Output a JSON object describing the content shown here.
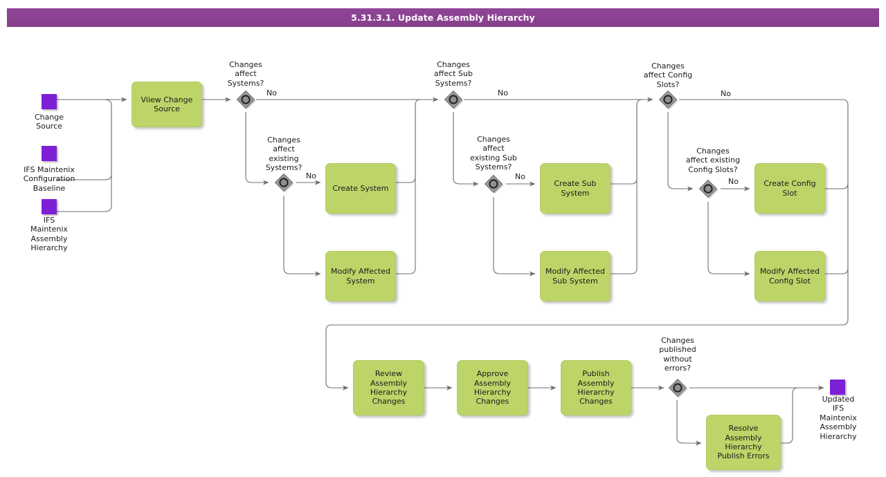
{
  "header": {
    "title": "5.31.3.1. Update Assembly Hierarchy"
  },
  "colors": {
    "header_purple": "#8b4292",
    "task_green": "#bdd568",
    "data_object_purple": "#7d1fd6",
    "gateway_gray": "#9a9a9a",
    "connector_gray": "#707070"
  },
  "diagram": {
    "type": "bpmn-process-flow",
    "data_objects": [
      {
        "id": "do-change-source",
        "label": "Change\nSource"
      },
      {
        "id": "do-config-baseline",
        "label": "IFS Maintenix\nConfiguration\nBaseline"
      },
      {
        "id": "do-assembly-hierarchy",
        "label": "IFS\nMaintenix\nAssembly\nHierarchy"
      },
      {
        "id": "do-updated-hierarchy",
        "label": "Updated\nIFS\nMaintenix\nAssembly\nHierarchy"
      }
    ],
    "tasks": [
      {
        "id": "task-view-change-source",
        "label": "Viiew Change\nSource"
      },
      {
        "id": "task-create-system",
        "label": "Create System"
      },
      {
        "id": "task-modify-affected-system",
        "label": "Modify Affected\nSystem"
      },
      {
        "id": "task-create-sub-system",
        "label": "Create Sub\nSystem"
      },
      {
        "id": "task-modify-affected-sub-system",
        "label": "Modify Affected\nSub System"
      },
      {
        "id": "task-create-config-slot",
        "label": "Create Config\nSlot"
      },
      {
        "id": "task-modify-affected-config-slot",
        "label": "Modify Affected\nConfig Slot"
      },
      {
        "id": "task-review-changes",
        "label": "Review\nAssembly\nHierarchy\nChanges"
      },
      {
        "id": "task-approve-changes",
        "label": "Approve\nAssembly\nHierarchy\nChanges"
      },
      {
        "id": "task-publish-changes",
        "label": "Publish\nAssembly\nHierarchy\nChanges"
      },
      {
        "id": "task-resolve-publish-errors",
        "label": "Resolve\nAssembly\nHierarchy\nPublish Errors"
      }
    ],
    "gateways": [
      {
        "id": "gw-affect-systems",
        "label": "Changes\naffect\nSystems?"
      },
      {
        "id": "gw-affect-existing-systems",
        "label": "Changes\naffect\nexisting\nSystems?"
      },
      {
        "id": "gw-affect-sub-systems",
        "label": "Changes\naffect Sub\nSystems?"
      },
      {
        "id": "gw-affect-existing-sub-systems",
        "label": "Changes\naffect\nexisting Sub\nSystems?"
      },
      {
        "id": "gw-affect-config-slots",
        "label": "Changes\naffect Config\nSlots?"
      },
      {
        "id": "gw-affect-existing-config-slots",
        "label": "Changes\naffect existing\nConfig Slots?"
      },
      {
        "id": "gw-published-without-errors",
        "label": "Changes\npublished\nwithout\nerrors?"
      }
    ],
    "edge_labels": [
      {
        "id": "edge-no-systems",
        "label": "No"
      },
      {
        "id": "edge-no-existing-systems",
        "label": "No"
      },
      {
        "id": "edge-no-sub-systems",
        "label": "No"
      },
      {
        "id": "edge-no-existing-sub-systems",
        "label": "No"
      },
      {
        "id": "edge-no-config-slots",
        "label": "No"
      },
      {
        "id": "edge-no-existing-config-slots",
        "label": "No"
      }
    ]
  }
}
